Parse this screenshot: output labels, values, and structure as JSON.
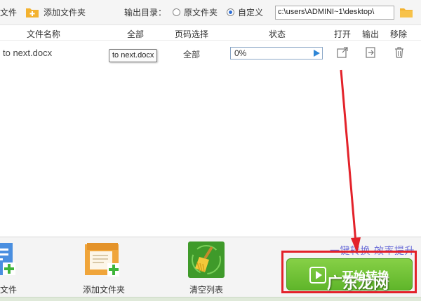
{
  "toolbar": {
    "add_file_label": "文件",
    "add_folder_label": "添加文件夹",
    "output_dir_label": "输出目录：",
    "option_original": "原文件夹",
    "option_custom": "自定义",
    "selected_option": "自定义",
    "output_path": "c:\\users\\ADMINI~1\\desktop\\"
  },
  "table": {
    "columns": [
      "文件名称",
      "全部",
      "页码选择",
      "状态",
      "打开",
      "输出",
      "移除"
    ],
    "rows": [
      {
        "filename": "to next.docx",
        "tooltip": "to next.docx",
        "pages": "全部",
        "progress_text": "0%",
        "progress_fraction": 0
      }
    ]
  },
  "bottom": {
    "add_file_label": "文件",
    "add_folder_label": "添加文件夹",
    "clear_list_label": "清空列表",
    "slogan": "一键转换  效率提升",
    "start_button_label": "开始转换"
  },
  "watermark": "广东龙网",
  "colors": {
    "accent_green": "#6cc23a",
    "annotation_red": "#e3222a",
    "slogan_purple": "#6d6fd8",
    "folder_orange": "#f3b22f"
  }
}
